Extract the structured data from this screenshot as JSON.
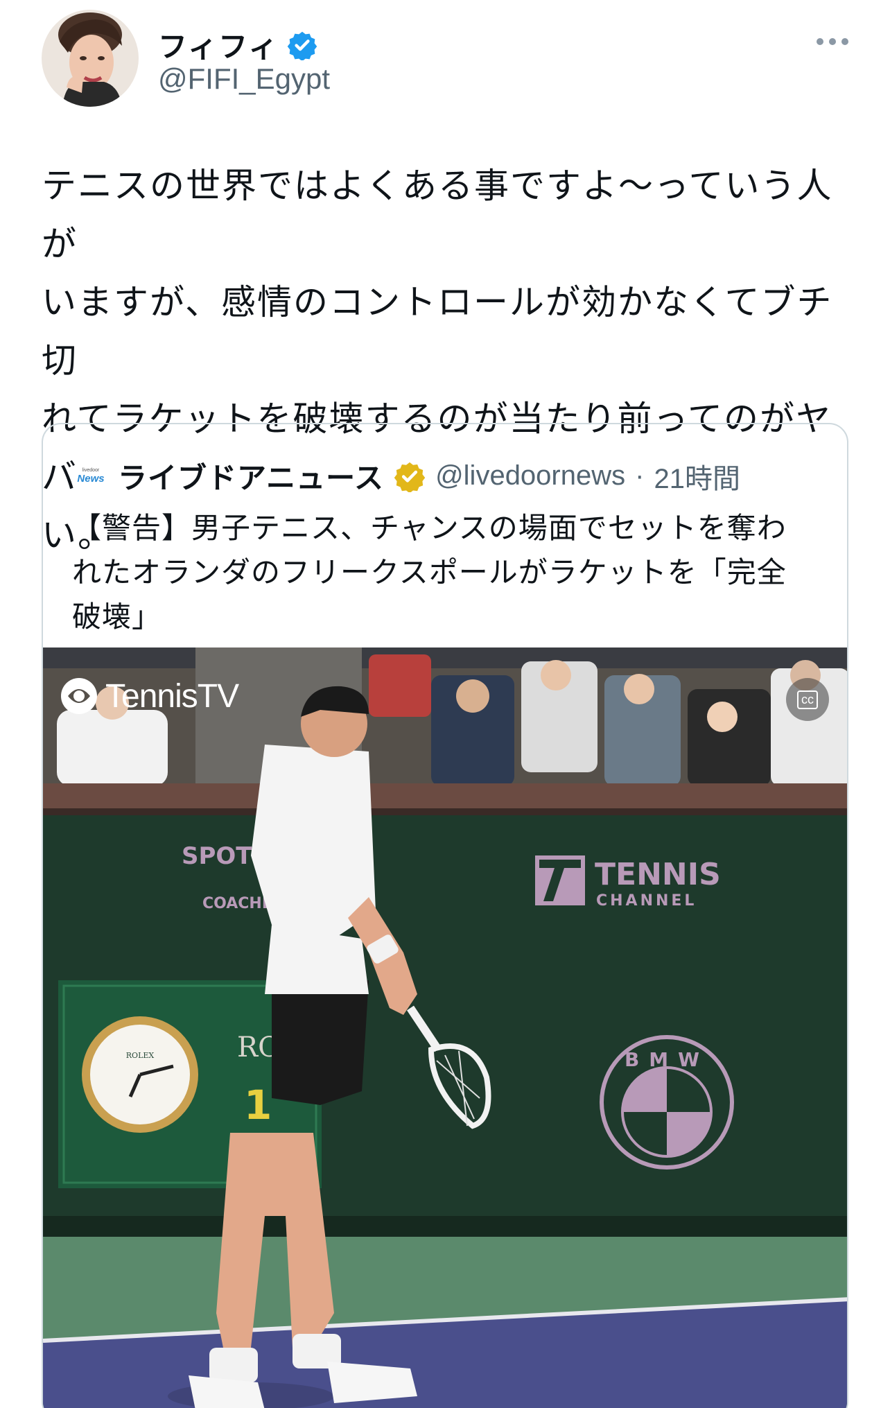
{
  "author": {
    "display_name": "フィフィ",
    "handle": "@FIFI_Egypt",
    "verified": true,
    "verified_color": "#1d9bf0"
  },
  "menu_icon": "more-horizontal-icon",
  "tweet": {
    "lines": [
      "テニスの世界ではよくある事ですよ〜っていう人が",
      "いますが、感情のコントロールが効かなくてブチ切",
      "れてラケットを破壊するのが当たり前ってのがヤバ",
      "い。"
    ]
  },
  "quoted": {
    "logo_top": "livedoor",
    "logo_bottom": "News",
    "display_name": "ライブドアニュース",
    "badge_color": "#e2b719",
    "handle": "@livedoornews",
    "separator": "·",
    "time": "21時間",
    "lines": [
      "【警告】男子テニス、チャンスの場面でセットを奪わ",
      "れたオランダのフリークスポールがラケットを「完全",
      "破壊」"
    ]
  },
  "video": {
    "brand": "TennisTV",
    "cc_label": "cc",
    "sign_left_1": "SPOTLIG",
    "sign_left_2": "C",
    "sign_left_3": "COACHE",
    "sign_right_1": "TENNIS",
    "sign_right_2": "CHANNEL",
    "clock_brand": "ROLEX",
    "scoreboard_text": "RO",
    "scoreboard_digit": "1",
    "bmw_text": "BMW"
  }
}
